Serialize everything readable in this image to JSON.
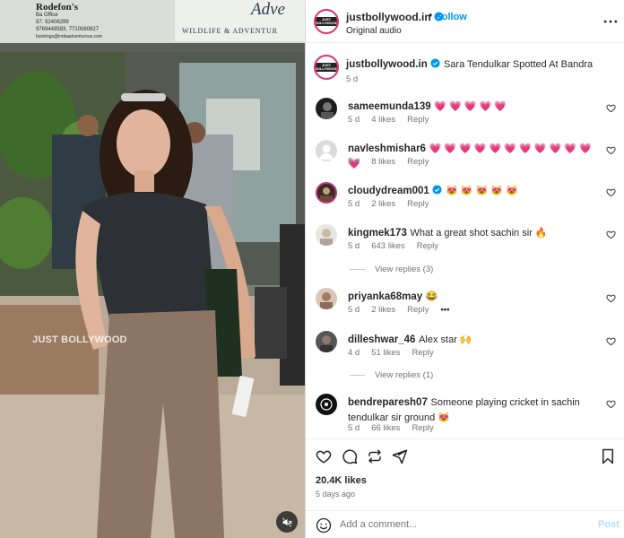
{
  "video": {
    "watermark": "JUST BOLLYWOOD",
    "sign_name": "Rodefon's",
    "sign_line1": "Ba     Office",
    "sign_line2": "97.  92406299",
    "sign_line3": "9769449583, 7710080827",
    "sign_line4": "bookings@indiaadventurous.com",
    "adv_text": "Adve",
    "adv_subtext": "WILDLIFE & ADVENTUR"
  },
  "header": {
    "username": "justbollywood.in",
    "dot": "•",
    "follow_label": "Follow",
    "audio_label": "Original audio",
    "logo_text_top": "JUST",
    "logo_text_bottom": "BOLLYWOOD"
  },
  "caption": {
    "username": "justbollywood.in",
    "text": "Sara Tendulkar Spotted At Bandra",
    "time": "5 d"
  },
  "comments": [
    {
      "username": "sameemunda139",
      "text": "💗 💗 💗 💗 💗",
      "time": "5 d",
      "likes": "4 likes",
      "reply": "Reply",
      "verified": false,
      "avatar": "dark"
    },
    {
      "username": "navleshmishar6",
      "text": "💗 💗 💗 💗 💗 💗 💗 💗 💗 💗 💗 💗",
      "time": "5 d",
      "likes": "8 likes",
      "reply": "Reply",
      "verified": false,
      "avatar": "default"
    },
    {
      "username": "cloudydream001",
      "text": "😻 😻 😻 😻 😻",
      "time": "5 d",
      "likes": "2 likes",
      "reply": "Reply",
      "verified": true,
      "avatar": "ring"
    },
    {
      "username": "kingmek173",
      "text": "What a great shot sachin sir 🔥",
      "time": "5 d",
      "likes": "643 likes",
      "reply": "Reply",
      "verified": false,
      "avatar": "light",
      "view_replies": "View replies (3)"
    },
    {
      "username": "priyanka68may",
      "text": "😂",
      "time": "5 d",
      "likes": "2 likes",
      "reply": "Reply",
      "verified": false,
      "avatar": "brown",
      "more": "•••"
    },
    {
      "username": "dilleshwar_46",
      "text": "Alex star 🙌",
      "time": "4 d",
      "likes": "51 likes",
      "reply": "Reply",
      "verified": false,
      "avatar": "gray",
      "view_replies": "View replies (1)"
    },
    {
      "username": "bendreparesh07",
      "text": "Someone playing cricket in sachin tendulkar sir ground 😻",
      "time": "5 d",
      "likes": "66 likes",
      "reply": "Reply",
      "verified": false,
      "avatar": "black"
    }
  ],
  "actions": {
    "likes": "20.4K likes",
    "ago": "5 days ago",
    "add_comment_placeholder": "Add a comment...",
    "post_label": "Post"
  },
  "colors": {
    "accent_blue": "#0095f6",
    "heart_pink": "#ed4956",
    "verified_blue": "#0095f6"
  }
}
